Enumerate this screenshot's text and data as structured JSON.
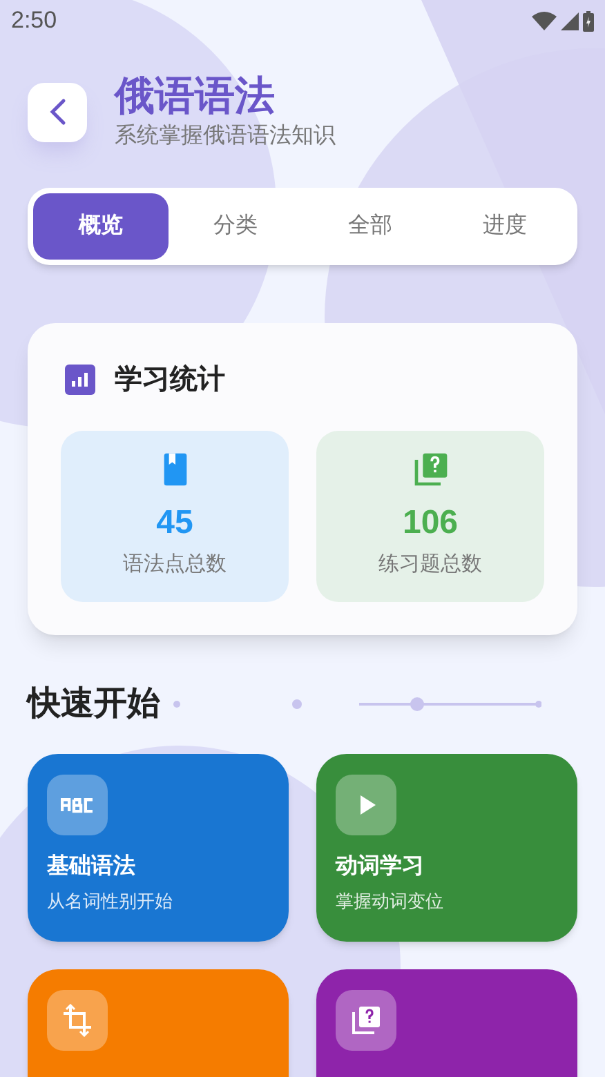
{
  "status_bar": {
    "time": "2:50"
  },
  "header": {
    "title": "俄语语法",
    "subtitle": "系统掌握俄语语法知识"
  },
  "tabs": [
    {
      "label": "概览",
      "selected": true
    },
    {
      "label": "分类",
      "selected": false
    },
    {
      "label": "全部",
      "selected": false
    },
    {
      "label": "进度",
      "selected": false
    }
  ],
  "stats": {
    "title": "学习统计",
    "items": [
      {
        "kind": "book",
        "value": "45",
        "label": "语法点总数",
        "color": "#2196f3"
      },
      {
        "kind": "quiz",
        "value": "106",
        "label": "练习题总数",
        "color": "#4caf50"
      }
    ]
  },
  "quick_start": {
    "title": "快速开始",
    "cards": [
      {
        "kind": "abc",
        "title": "基础语法",
        "subtitle": "从名词性别开始",
        "color": "#1976d2"
      },
      {
        "kind": "play",
        "title": "动词学习",
        "subtitle": "掌握动词变位",
        "color": "#388e3c"
      },
      {
        "kind": "crop",
        "color": "#f57c00"
      },
      {
        "kind": "quiz",
        "color": "#8e24aa"
      }
    ]
  }
}
